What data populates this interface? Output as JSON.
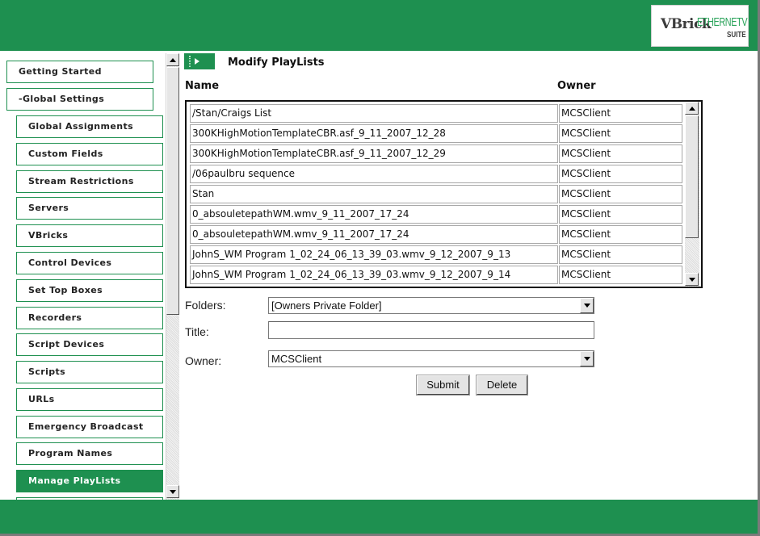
{
  "header": {
    "logo": {
      "brand": "VBrick",
      "product": "ETHERNETV",
      "suite": "SUITE"
    }
  },
  "sidebar": {
    "items": [
      {
        "label": "Getting Started",
        "level": "top",
        "active": false
      },
      {
        "label": "-Global Settings",
        "level": "top",
        "active": false
      },
      {
        "label": "Global Assignments",
        "level": "sub",
        "active": false
      },
      {
        "label": "Custom Fields",
        "level": "sub",
        "active": false
      },
      {
        "label": "Stream Restrictions",
        "level": "sub",
        "active": false
      },
      {
        "label": "Servers",
        "level": "sub",
        "active": false
      },
      {
        "label": "VBricks",
        "level": "sub",
        "active": false
      },
      {
        "label": "Control Devices",
        "level": "sub",
        "active": false
      },
      {
        "label": "Set Top Boxes",
        "level": "sub",
        "active": false
      },
      {
        "label": "Recorders",
        "level": "sub",
        "active": false
      },
      {
        "label": "Script Devices",
        "level": "sub",
        "active": false
      },
      {
        "label": "Scripts",
        "level": "sub",
        "active": false
      },
      {
        "label": "URLs",
        "level": "sub",
        "active": false
      },
      {
        "label": "Emergency Broadcast",
        "level": "sub",
        "active": false
      },
      {
        "label": "Program Names",
        "level": "sub",
        "active": false
      },
      {
        "label": "Manage PlayLists",
        "level": "sub",
        "active": true
      }
    ]
  },
  "main": {
    "title": "Modify PlayLists",
    "columns": {
      "name": "Name",
      "owner": "Owner"
    },
    "playlists": [
      {
        "name": "/Stan/Craigs List",
        "owner": "MCSClient"
      },
      {
        "name": "300KHighMotionTemplateCBR.asf_9_11_2007_12_28",
        "owner": "MCSClient"
      },
      {
        "name": "300KHighMotionTemplateCBR.asf_9_11_2007_12_29",
        "owner": "MCSClient"
      },
      {
        "name": "/06paulbru sequence",
        "owner": "MCSClient"
      },
      {
        "name": "Stan",
        "owner": "MCSClient"
      },
      {
        "name": "0_absouletepathWM.wmv_9_11_2007_17_24",
        "owner": "MCSClient"
      },
      {
        "name": "0_absouletepathWM.wmv_9_11_2007_17_24",
        "owner": "MCSClient"
      },
      {
        "name": "JohnS_WM Program 1_02_24_06_13_39_03.wmv_9_12_2007_9_13",
        "owner": "MCSClient"
      },
      {
        "name": "JohnS_WM Program 1_02_24_06_13_39_03.wmv_9_12_2007_9_14",
        "owner": "MCSClient"
      }
    ],
    "form": {
      "folders_label": "Folders:",
      "folders_value": "[Owners Private Folder]",
      "title_label": "Title:",
      "title_value": "",
      "owner_label": "Owner:",
      "owner_value": "MCSClient",
      "submit_label": "Submit",
      "delete_label": "Delete"
    }
  },
  "colors": {
    "brand_green": "#1e9050"
  }
}
